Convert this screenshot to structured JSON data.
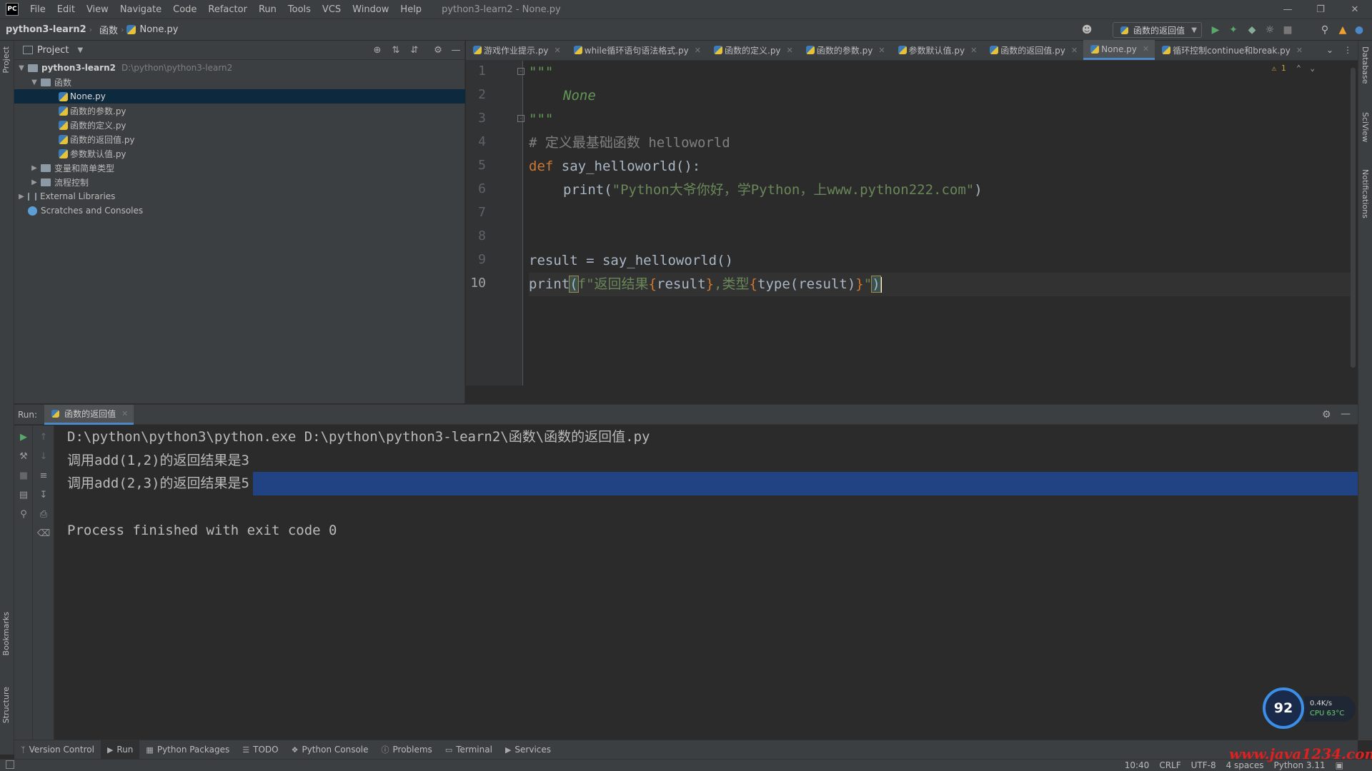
{
  "menubar": {
    "logo": "PC",
    "items": [
      "File",
      "Edit",
      "View",
      "Navigate",
      "Code",
      "Refactor",
      "Run",
      "Tools",
      "VCS",
      "Window",
      "Help"
    ],
    "window_title": "python3-learn2 - None.py"
  },
  "breadcrumb": [
    "python3-learn2",
    "函数",
    "None.py"
  ],
  "run_config": "函数的返回值",
  "project": {
    "header": "Project",
    "tree": [
      {
        "label": "python3-learn2",
        "hint": "D:\\python\\python3-learn2"
      },
      {
        "label": "函数"
      },
      {
        "label": "None.py"
      },
      {
        "label": "函数的参数.py"
      },
      {
        "label": "函数的定义.py"
      },
      {
        "label": "函数的返回值.py"
      },
      {
        "label": "参数默认值.py"
      },
      {
        "label": "变量和简单类型"
      },
      {
        "label": "流程控制"
      },
      {
        "label": "External Libraries"
      },
      {
        "label": "Scratches and Consoles"
      }
    ]
  },
  "editor": {
    "tabs": [
      "游戏作业提示.py",
      "while循环语句语法格式.py",
      "函数的定义.py",
      "函数的参数.py",
      "参数默认值.py",
      "函数的返回值.py",
      "None.py",
      "循环控制continue和break.py"
    ],
    "active_tab": 6,
    "warning_count": "1",
    "line_numbers": [
      "1",
      "2",
      "3",
      "4",
      "5",
      "6",
      "7",
      "8",
      "9",
      "10"
    ],
    "code": {
      "l1": "\"\"\"",
      "l2": "None",
      "l3": "\"\"\"",
      "l4": "# 定义最基础函数 helloworld",
      "l5_kw": "def",
      "l5_rest": " say_helloworld():",
      "l6_a": "print(",
      "l6_str": "\"Python大爷你好，学Python，上www.python222.com\"",
      "l6_b": ")",
      "l9": "result = say_helloworld()",
      "l10_a": "print",
      "l10_paren": "(",
      "l10_f": "f\"返回结果",
      "l10_b1": "{",
      "l10_v1": "result",
      "l10_b2": "}",
      "l10_mid": ",类型",
      "l10_b3": "{",
      "l10_v2": "type(result)",
      "l10_b4": "}",
      "l10_end": "\"",
      "l10_close": ")"
    }
  },
  "run": {
    "label": "Run:",
    "tab": "函数的返回值",
    "output": [
      "D:\\python\\python3\\python.exe D:\\python\\python3-learn2\\函数\\函数的返回值.py",
      "调用add(1,2)的返回结果是3",
      "调用add(2,3)的返回结果是5",
      "",
      "Process finished with exit code 0"
    ]
  },
  "left_strip": {
    "project": "Project",
    "bookmarks": "Bookmarks",
    "structure": "Structure"
  },
  "right_strip": {
    "database": "Database",
    "sciview": "SciView",
    "notifications": "Notifications"
  },
  "bottom_tools": [
    "Version Control",
    "Run",
    "Python Packages",
    "TODO",
    "Python Console",
    "Problems",
    "Terminal",
    "Services"
  ],
  "status": {
    "position": "10:40",
    "line_sep": "CRLF",
    "encoding": "UTF-8",
    "indent": "4 spaces",
    "interpreter": "Python 3.11"
  },
  "net_widget": {
    "value": "92",
    "speed": "0.4K/s",
    "cpu": "CPU 63°C"
  },
  "watermark": "www.java1234.com"
}
